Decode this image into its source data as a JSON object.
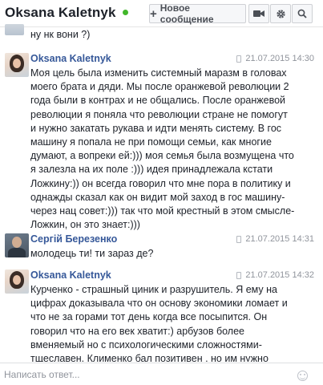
{
  "header": {
    "title": "Oksana Kaletnyk",
    "new_message_label": "Новое сообщение",
    "online_status_color": "#42b72a"
  },
  "top_fragment": {
    "text": "ну нк вони ?)"
  },
  "messages": [
    {
      "sender": "Oksana Kaletnyk",
      "time": "21.07.2015 14:30",
      "text": "Моя цель была изменить системный маразм в головах моего брата и дяди. Мы после оранжевой революции 2 года были в контрах и не общались. После оранжевой революции я поняла что революции стране не помогут и нужно закатать рукава и идти менять систему. В гос машину я попала не при помощи семьи, как многие думают, а вопреки ей:))) моя семья была возмущена что я залезла на их поле :))) идея принадлежала кстати Ложкину:)) он всегда говорил что мне пора в политику и однажды сказал как он видит мой заход в гос машину- через нац совет:))) так что мой крестный в этом смысле- Ложкин, он это знает:)))"
    },
    {
      "sender": "Сергій Березенко",
      "time": "21.07.2015 14:31",
      "text": "молодець ти! ти зараз де?"
    },
    {
      "sender": "Oksana Kaletnyk",
      "time": "21.07.2015 14:32",
      "text": "Курченко - страшный циник и разрушитель. Я ему на цифрах доказывала что он основу экономики ломает и что не за горами тот день когда все посыпится. Он говорил что на его век хватит:) арбузов более вменяемый но с психологическими сложностями- тщеславен. Клименко бал позитивен , но им нужно"
    }
  ],
  "composer": {
    "placeholder": "Написать ответ..."
  },
  "colors": {
    "link": "#365899",
    "timestamp": "#90949c",
    "text": "#1d2129"
  }
}
